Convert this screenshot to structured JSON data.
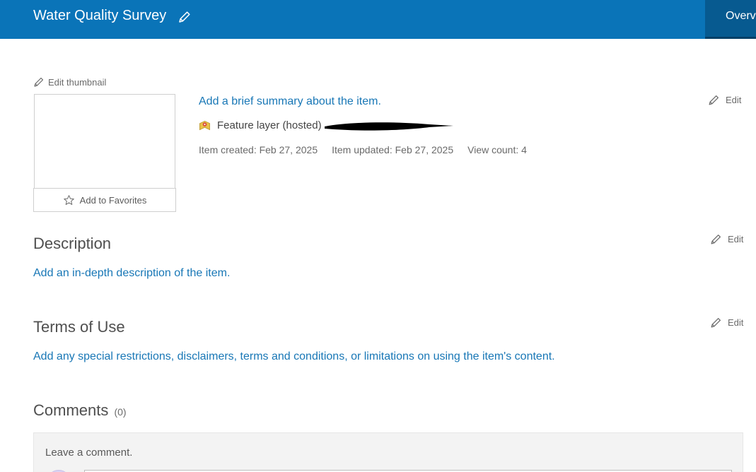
{
  "header": {
    "title": "Water Quality Survey",
    "title_edit_icon": "pencil-icon",
    "tab_overview": "Overview",
    "bar_color": "#0a74b8"
  },
  "thumbnail": {
    "edit_label": "Edit thumbnail",
    "favorites_label": "Add to Favorites"
  },
  "summary": {
    "placeholder_link": "Add a brief summary about the item.",
    "item_type": "Feature layer (hosted)",
    "item_type_icon": "feature-layer-icon",
    "item_created": "Item created: Feb 27, 2025",
    "item_updated": "Item updated: Feb 27, 2025",
    "view_count": "View count: 4",
    "edit_label": "Edit"
  },
  "description": {
    "heading": "Description",
    "placeholder_link": "Add an in-depth description of the item.",
    "edit_label": "Edit"
  },
  "terms": {
    "heading": "Terms of Use",
    "placeholder_link": "Add any special restrictions, disclaimers, terms and conditions, or limitations on using the item's content.",
    "edit_label": "Edit"
  },
  "comments": {
    "heading": "Comments",
    "count": "(0)",
    "prompt": "Leave a comment."
  },
  "colors": {
    "link": "#1877b6",
    "text": "#4a4a4a",
    "accent": "#0a74b8"
  }
}
